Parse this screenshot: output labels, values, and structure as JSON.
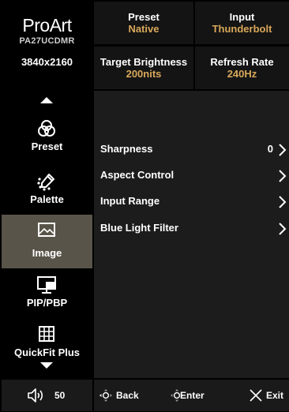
{
  "brand": {
    "logo": "ProArt",
    "model": "PA27UCDMR",
    "resolution": "3840x2160"
  },
  "info": {
    "preset_label": "Preset",
    "preset_value": "Native",
    "input_label": "Input",
    "input_value": "Thunderbolt",
    "brightness_label": "Target Brightness",
    "brightness_value": "200nits",
    "refresh_label": "Refresh Rate",
    "refresh_value": "240Hz"
  },
  "colors": {
    "accent": "#d9a85a",
    "active_bg": "#595449",
    "panel_bg": "#1c1c1c"
  },
  "sidebar": {
    "items": [
      {
        "label": "Preset",
        "icon": "preset-circles-icon",
        "active": false
      },
      {
        "label": "Palette",
        "icon": "palette-dropper-icon",
        "active": false
      },
      {
        "label": "Image",
        "icon": "image-icon",
        "active": true
      },
      {
        "label": "PIP/PBP",
        "icon": "pip-pbp-icon",
        "active": false
      },
      {
        "label": "QuickFit Plus",
        "icon": "quickfit-grid-icon",
        "active": false
      }
    ]
  },
  "menu": {
    "items": [
      {
        "label": "Sharpness",
        "value": "0"
      },
      {
        "label": "Aspect Control",
        "value": ""
      },
      {
        "label": "Input Range",
        "value": ""
      },
      {
        "label": "Blue Light Filter",
        "value": ""
      }
    ]
  },
  "footer": {
    "volume": "50",
    "back": "Back",
    "enter": "Enter",
    "exit": "Exit"
  }
}
